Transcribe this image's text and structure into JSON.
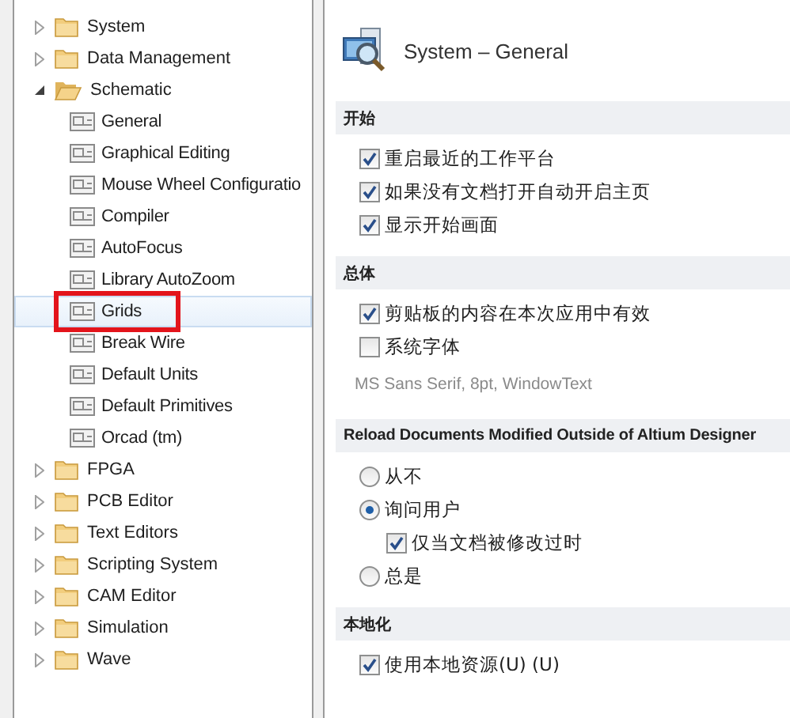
{
  "tree": {
    "items": [
      {
        "label": "System",
        "expanded": false,
        "selected": false,
        "highlighted": false
      },
      {
        "label": "Data Management",
        "expanded": false,
        "selected": false,
        "highlighted": false
      },
      {
        "label": "Schematic",
        "expanded": true,
        "selected": false,
        "highlighted": false,
        "children": [
          {
            "label": "General",
            "selected": false,
            "highlighted": false
          },
          {
            "label": "Graphical Editing",
            "selected": false,
            "highlighted": false
          },
          {
            "label": "Mouse Wheel Configuratio",
            "selected": false,
            "highlighted": false
          },
          {
            "label": "Compiler",
            "selected": false,
            "highlighted": false
          },
          {
            "label": "AutoFocus",
            "selected": false,
            "highlighted": false
          },
          {
            "label": "Library AutoZoom",
            "selected": false,
            "highlighted": false
          },
          {
            "label": "Grids",
            "selected": true,
            "highlighted": true
          },
          {
            "label": "Break Wire",
            "selected": false,
            "highlighted": false
          },
          {
            "label": "Default Units",
            "selected": false,
            "highlighted": false
          },
          {
            "label": "Default Primitives",
            "selected": false,
            "highlighted": false
          },
          {
            "label": "Orcad (tm)",
            "selected": false,
            "highlighted": false
          }
        ]
      },
      {
        "label": "FPGA",
        "expanded": false,
        "selected": false,
        "highlighted": false
      },
      {
        "label": "PCB Editor",
        "expanded": false,
        "selected": false,
        "highlighted": false
      },
      {
        "label": "Text Editors",
        "expanded": false,
        "selected": false,
        "highlighted": false
      },
      {
        "label": "Scripting System",
        "expanded": false,
        "selected": false,
        "highlighted": false
      },
      {
        "label": "CAM Editor",
        "expanded": false,
        "selected": false,
        "highlighted": false
      },
      {
        "label": "Simulation",
        "expanded": false,
        "selected": false,
        "highlighted": false
      },
      {
        "label": "Wave",
        "expanded": false,
        "selected": false,
        "highlighted": false
      }
    ]
  },
  "panel": {
    "title": "System – General",
    "sections": [
      {
        "heading": "开始",
        "items": [
          {
            "kind": "checkbox",
            "label": "重启最近的工作平台",
            "checked": true
          },
          {
            "kind": "checkbox",
            "label": "如果没有文档打开自动开启主页",
            "checked": true
          },
          {
            "kind": "checkbox",
            "label": "显示开始画面",
            "checked": true
          }
        ]
      },
      {
        "heading": "总体",
        "items": [
          {
            "kind": "checkbox",
            "label": "剪贴板的内容在本次应用中有效",
            "checked": true
          },
          {
            "kind": "checkbox",
            "label": "系统字体",
            "checked": false
          },
          {
            "kind": "note",
            "label": "MS Sans Serif, 8pt, WindowText"
          }
        ]
      },
      {
        "heading": "Reload Documents Modified Outside of Altium Designer",
        "items": [
          {
            "kind": "radio",
            "label": "从不",
            "selected": false
          },
          {
            "kind": "radio",
            "label": "询问用户",
            "selected": true,
            "children": [
              {
                "kind": "checkbox",
                "label": "仅当文档被修改过时",
                "checked": true
              }
            ]
          },
          {
            "kind": "radio",
            "label": "总是",
            "selected": false
          }
        ]
      },
      {
        "heading": "本地化",
        "items": [
          {
            "kind": "checkbox",
            "label": "使用本地资源(U) (U)",
            "checked": true
          }
        ]
      }
    ]
  }
}
